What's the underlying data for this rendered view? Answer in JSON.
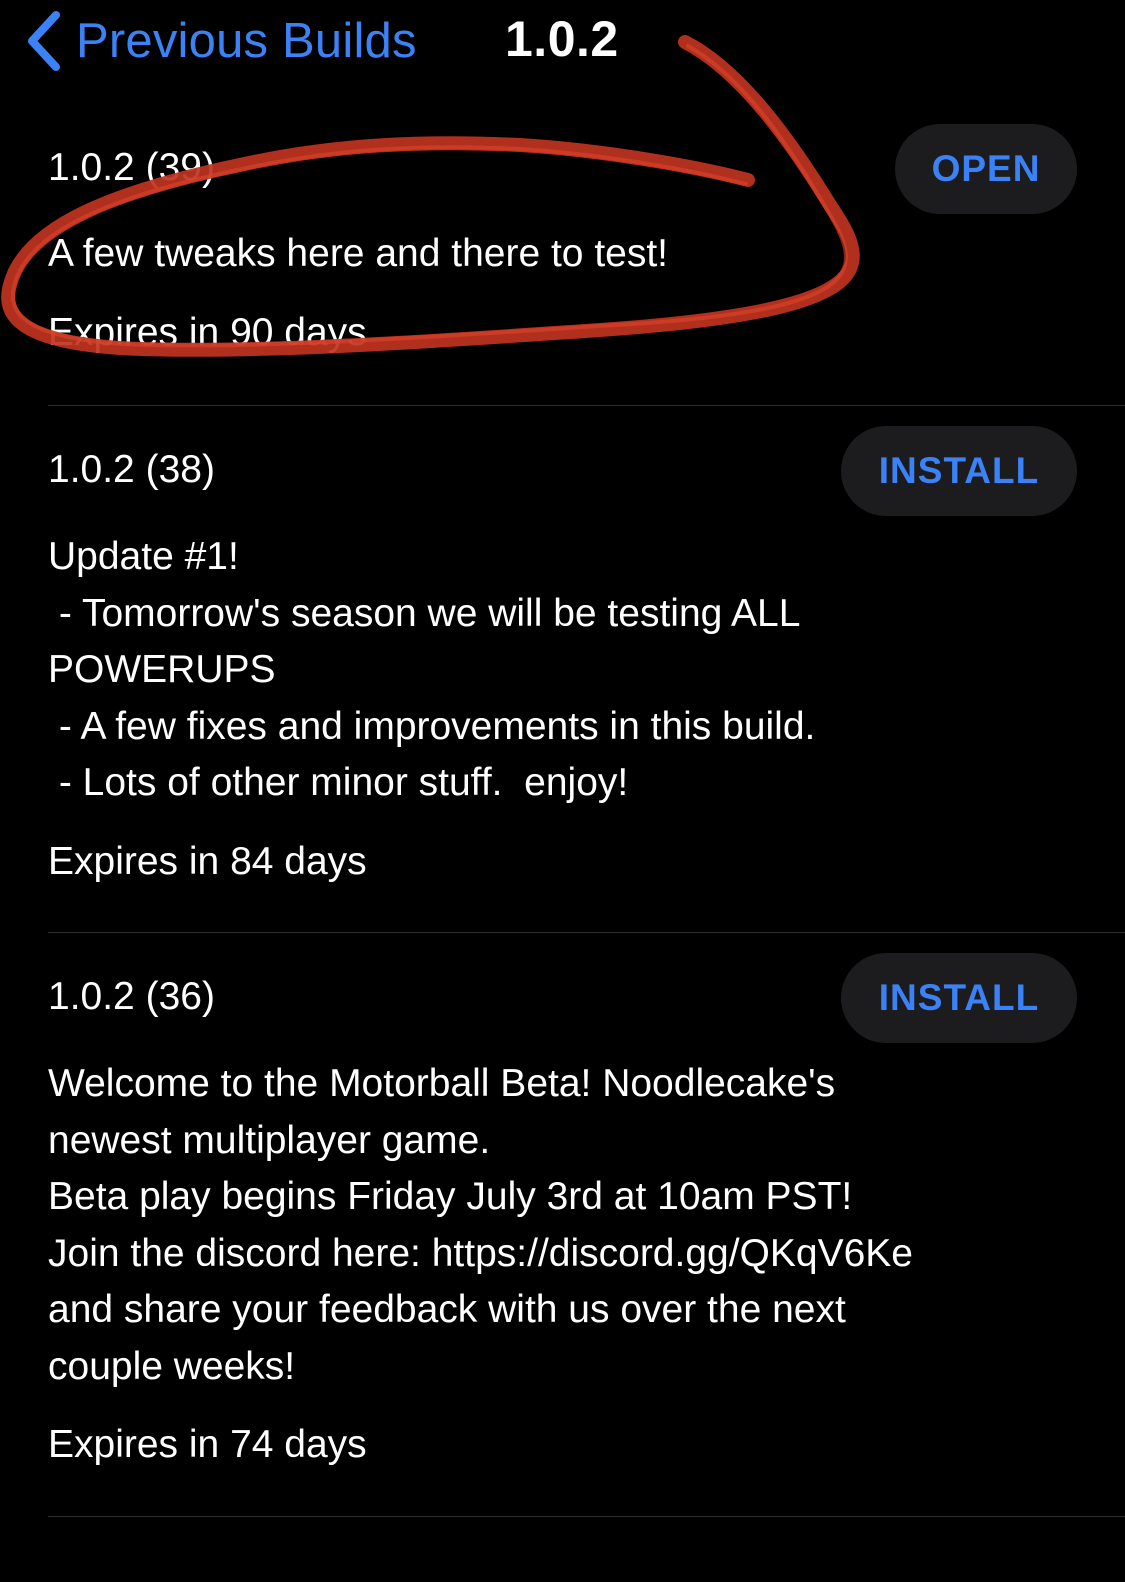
{
  "nav": {
    "back_label": "Previous Builds",
    "title": "1.0.2"
  },
  "builds": [
    {
      "version": "1.0.2 (39)",
      "action": "OPEN",
      "notes": "A few tweaks here and there to test!",
      "expires": "Expires in 90 days"
    },
    {
      "version": "1.0.2 (38)",
      "action": "INSTALL",
      "notes": "Update #1!\n - Tomorrow's season we will be testing ALL\nPOWERUPS\n - A few fixes and improvements in this build.\n - Lots of other minor stuff.  enjoy!",
      "expires": "Expires in 84 days"
    },
    {
      "version": "1.0.2 (36)",
      "action": "INSTALL",
      "notes": "Welcome to the Motorball Beta! Noodlecake's\nnewest multiplayer game.\nBeta play begins Friday July 3rd at 10am PST!\nJoin the discord here: https://discord.gg/QKqV6Ke\nand share your feedback with us over the next\ncouple weeks!",
      "expires": "Expires in 74 days"
    }
  ],
  "colors": {
    "accent": "#3b82f6",
    "background": "#000000",
    "pill_background": "#1c1c1e",
    "divider": "#2c2c2e",
    "annotation": "#c0331f"
  },
  "icons": {
    "back": "chevron-left-icon"
  }
}
